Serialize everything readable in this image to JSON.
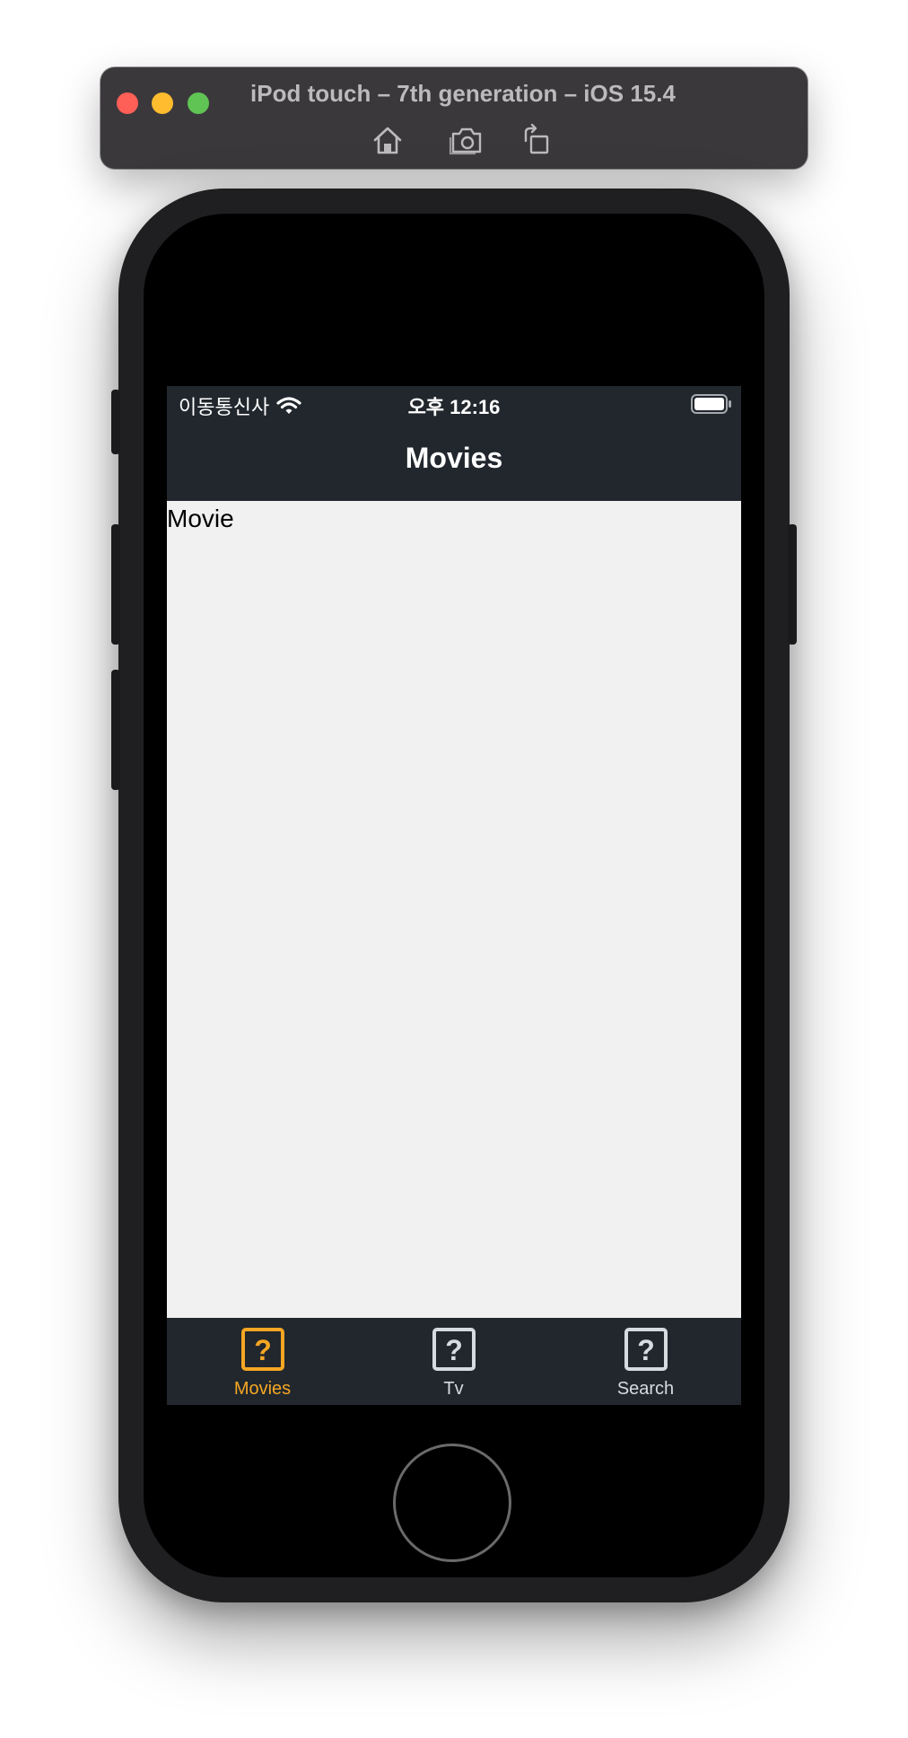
{
  "simulator": {
    "title": "iPod touch – 7th generation – iOS 15.4",
    "tools": [
      {
        "icon": "home-icon"
      },
      {
        "icon": "screenshot-icon"
      },
      {
        "icon": "rotate-icon"
      }
    ]
  },
  "status_bar": {
    "carrier": "이동통신사",
    "time": "오후 12:16"
  },
  "nav": {
    "title": "Movies"
  },
  "content": {
    "label": "Movie"
  },
  "tabs": [
    {
      "label": "Movies",
      "icon": "question-mark-icon",
      "selected": true
    },
    {
      "label": "Tv",
      "icon": "question-mark-icon",
      "selected": false
    },
    {
      "label": "Search",
      "icon": "question-mark-icon",
      "selected": false
    }
  ],
  "colors": {
    "bar_background": "#21272d",
    "content_background": "#f1f1f1",
    "tab_selected": "#f5a623",
    "tab_unselected": "#d7dbe0"
  }
}
